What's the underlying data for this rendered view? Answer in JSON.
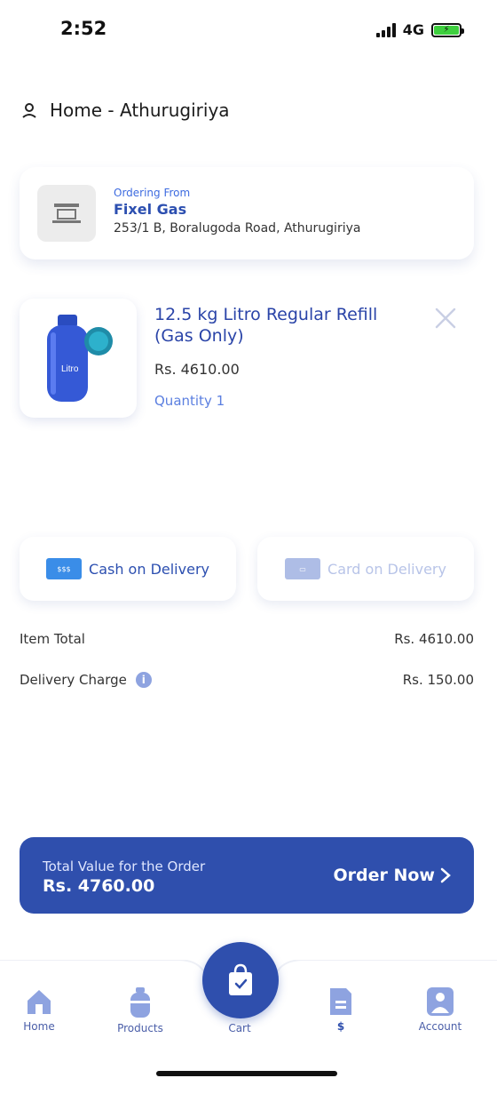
{
  "status_bar": {
    "time": "2:52",
    "network": "4G"
  },
  "location": {
    "label": "Home - Athurugiriya"
  },
  "store": {
    "ordering_from": "Ordering From",
    "name": "Fixel Gas",
    "address": "253/1 B, Boralugoda Road, Athurugiriya"
  },
  "product": {
    "title": "12.5 kg Litro Regular Refill (Gas Only)",
    "price": "Rs. 4610.00",
    "quantity": "Quantity 1"
  },
  "payment": {
    "cash_label": "Cash on Delivery",
    "card_label": "Card on Delivery"
  },
  "summary": {
    "item_total_label": "Item Total",
    "item_total_value": "Rs. 4610.00",
    "delivery_label": "Delivery Charge",
    "delivery_value": "Rs. 150.00"
  },
  "order": {
    "total_label": "Total Value for the Order",
    "total_value": "Rs. 4760.00",
    "order_now_label": "Order Now"
  },
  "nav": {
    "items": [
      {
        "label": "Home"
      },
      {
        "label": "Products"
      },
      {
        "label": "Cart"
      },
      {
        "label": "$"
      },
      {
        "label": "Account"
      }
    ]
  },
  "colors": {
    "primary": "#2f4fad",
    "accent": "#3d6be0",
    "muted": "#b8c4e8"
  }
}
